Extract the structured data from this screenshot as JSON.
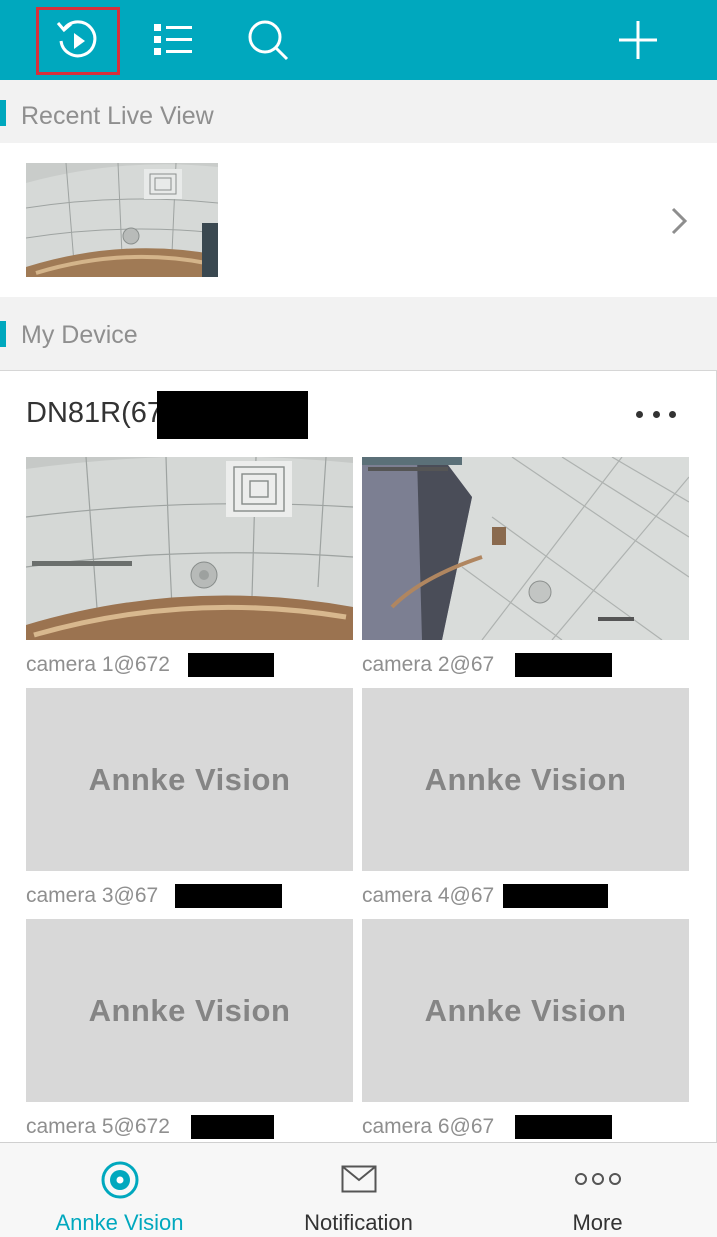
{
  "colors": {
    "accent": "#00a8be",
    "highlight_box": "#d6303a",
    "placeholder_bg": "#d8d8d8"
  },
  "toolbar": {
    "icons": [
      "playback-icon",
      "list-icon",
      "search-icon",
      "plus-icon"
    ]
  },
  "recent": {
    "title": "Recent Live View"
  },
  "my_device": {
    "title": "My Device",
    "device_name": "DN81R(67",
    "cameras": [
      {
        "label": "camera 1@672",
        "has_image": true
      },
      {
        "label": "camera 2@67",
        "has_image": true
      },
      {
        "label": "camera 3@67",
        "placeholder": "Annke Vision"
      },
      {
        "label": "camera 4@67",
        "placeholder": "Annke Vision"
      },
      {
        "label": "camera 5@672",
        "placeholder": "Annke Vision"
      },
      {
        "label": "camera 6@67",
        "placeholder": "Annke Vision"
      }
    ]
  },
  "tabs": [
    {
      "label": "Annke Vision",
      "icon": "camera-lens-icon",
      "active": true
    },
    {
      "label": "Notification",
      "icon": "envelope-icon",
      "active": false
    },
    {
      "label": "More",
      "icon": "more-dots-icon",
      "active": false
    }
  ]
}
